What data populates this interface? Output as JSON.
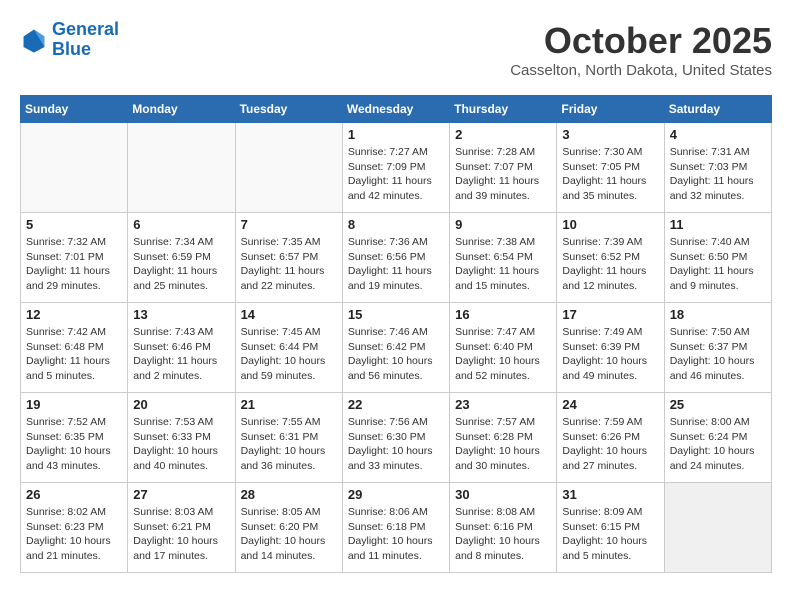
{
  "header": {
    "logo_line1": "General",
    "logo_line2": "Blue",
    "month": "October 2025",
    "location": "Casselton, North Dakota, United States"
  },
  "days_of_week": [
    "Sunday",
    "Monday",
    "Tuesday",
    "Wednesday",
    "Thursday",
    "Friday",
    "Saturday"
  ],
  "weeks": [
    [
      {
        "num": "",
        "info": "",
        "empty": true
      },
      {
        "num": "",
        "info": "",
        "empty": true
      },
      {
        "num": "",
        "info": "",
        "empty": true
      },
      {
        "num": "1",
        "info": "Sunrise: 7:27 AM\nSunset: 7:09 PM\nDaylight: 11 hours and 42 minutes."
      },
      {
        "num": "2",
        "info": "Sunrise: 7:28 AM\nSunset: 7:07 PM\nDaylight: 11 hours and 39 minutes."
      },
      {
        "num": "3",
        "info": "Sunrise: 7:30 AM\nSunset: 7:05 PM\nDaylight: 11 hours and 35 minutes."
      },
      {
        "num": "4",
        "info": "Sunrise: 7:31 AM\nSunset: 7:03 PM\nDaylight: 11 hours and 32 minutes."
      }
    ],
    [
      {
        "num": "5",
        "info": "Sunrise: 7:32 AM\nSunset: 7:01 PM\nDaylight: 11 hours and 29 minutes."
      },
      {
        "num": "6",
        "info": "Sunrise: 7:34 AM\nSunset: 6:59 PM\nDaylight: 11 hours and 25 minutes."
      },
      {
        "num": "7",
        "info": "Sunrise: 7:35 AM\nSunset: 6:57 PM\nDaylight: 11 hours and 22 minutes."
      },
      {
        "num": "8",
        "info": "Sunrise: 7:36 AM\nSunset: 6:56 PM\nDaylight: 11 hours and 19 minutes."
      },
      {
        "num": "9",
        "info": "Sunrise: 7:38 AM\nSunset: 6:54 PM\nDaylight: 11 hours and 15 minutes."
      },
      {
        "num": "10",
        "info": "Sunrise: 7:39 AM\nSunset: 6:52 PM\nDaylight: 11 hours and 12 minutes."
      },
      {
        "num": "11",
        "info": "Sunrise: 7:40 AM\nSunset: 6:50 PM\nDaylight: 11 hours and 9 minutes."
      }
    ],
    [
      {
        "num": "12",
        "info": "Sunrise: 7:42 AM\nSunset: 6:48 PM\nDaylight: 11 hours and 5 minutes."
      },
      {
        "num": "13",
        "info": "Sunrise: 7:43 AM\nSunset: 6:46 PM\nDaylight: 11 hours and 2 minutes."
      },
      {
        "num": "14",
        "info": "Sunrise: 7:45 AM\nSunset: 6:44 PM\nDaylight: 10 hours and 59 minutes."
      },
      {
        "num": "15",
        "info": "Sunrise: 7:46 AM\nSunset: 6:42 PM\nDaylight: 10 hours and 56 minutes."
      },
      {
        "num": "16",
        "info": "Sunrise: 7:47 AM\nSunset: 6:40 PM\nDaylight: 10 hours and 52 minutes."
      },
      {
        "num": "17",
        "info": "Sunrise: 7:49 AM\nSunset: 6:39 PM\nDaylight: 10 hours and 49 minutes."
      },
      {
        "num": "18",
        "info": "Sunrise: 7:50 AM\nSunset: 6:37 PM\nDaylight: 10 hours and 46 minutes."
      }
    ],
    [
      {
        "num": "19",
        "info": "Sunrise: 7:52 AM\nSunset: 6:35 PM\nDaylight: 10 hours and 43 minutes."
      },
      {
        "num": "20",
        "info": "Sunrise: 7:53 AM\nSunset: 6:33 PM\nDaylight: 10 hours and 40 minutes."
      },
      {
        "num": "21",
        "info": "Sunrise: 7:55 AM\nSunset: 6:31 PM\nDaylight: 10 hours and 36 minutes."
      },
      {
        "num": "22",
        "info": "Sunrise: 7:56 AM\nSunset: 6:30 PM\nDaylight: 10 hours and 33 minutes."
      },
      {
        "num": "23",
        "info": "Sunrise: 7:57 AM\nSunset: 6:28 PM\nDaylight: 10 hours and 30 minutes."
      },
      {
        "num": "24",
        "info": "Sunrise: 7:59 AM\nSunset: 6:26 PM\nDaylight: 10 hours and 27 minutes."
      },
      {
        "num": "25",
        "info": "Sunrise: 8:00 AM\nSunset: 6:24 PM\nDaylight: 10 hours and 24 minutes."
      }
    ],
    [
      {
        "num": "26",
        "info": "Sunrise: 8:02 AM\nSunset: 6:23 PM\nDaylight: 10 hours and 21 minutes."
      },
      {
        "num": "27",
        "info": "Sunrise: 8:03 AM\nSunset: 6:21 PM\nDaylight: 10 hours and 17 minutes."
      },
      {
        "num": "28",
        "info": "Sunrise: 8:05 AM\nSunset: 6:20 PM\nDaylight: 10 hours and 14 minutes."
      },
      {
        "num": "29",
        "info": "Sunrise: 8:06 AM\nSunset: 6:18 PM\nDaylight: 10 hours and 11 minutes."
      },
      {
        "num": "30",
        "info": "Sunrise: 8:08 AM\nSunset: 6:16 PM\nDaylight: 10 hours and 8 minutes."
      },
      {
        "num": "31",
        "info": "Sunrise: 8:09 AM\nSunset: 6:15 PM\nDaylight: 10 hours and 5 minutes."
      },
      {
        "num": "",
        "info": "",
        "empty": true,
        "shaded": true
      }
    ]
  ]
}
